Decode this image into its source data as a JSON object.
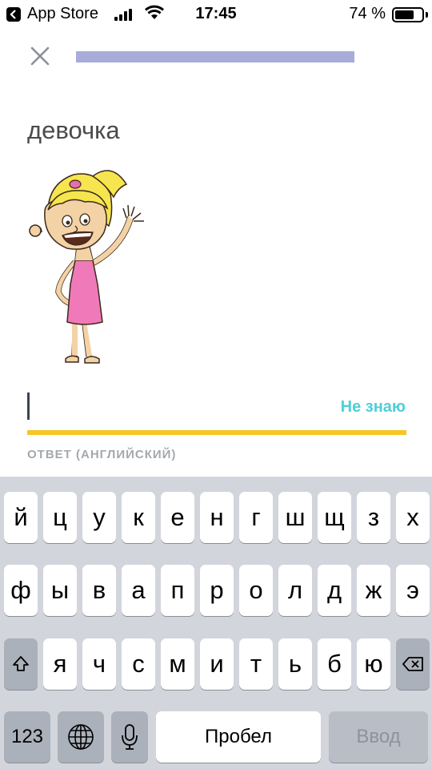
{
  "status_bar": {
    "back_app": "App Store",
    "time": "17:45",
    "battery_text": "74 %",
    "battery_level": 0.74
  },
  "lesson": {
    "progress": 1.0,
    "progress_color": "#a7acd9",
    "word": "девочка",
    "illustration": "girl-waving-illustration"
  },
  "answer": {
    "value": "",
    "dont_know_label": "Не знаю",
    "dont_know_color": "#4fcfd6",
    "hint": "ОТВЕТ (АНГЛИЙСКИЙ)",
    "underline_color": "#f5c626"
  },
  "keyboard": {
    "row1": [
      "й",
      "ц",
      "у",
      "к",
      "е",
      "н",
      "г",
      "ш",
      "щ",
      "з",
      "х"
    ],
    "row2": [
      "ф",
      "ы",
      "в",
      "а",
      "п",
      "р",
      "о",
      "л",
      "д",
      "ж",
      "э"
    ],
    "row3": [
      "я",
      "ч",
      "с",
      "м",
      "и",
      "т",
      "ь",
      "б",
      "ю"
    ],
    "numbers_label": "123",
    "space_label": "Пробел",
    "return_label": "Ввод",
    "shift_icon": "shift-icon",
    "delete_icon": "delete-icon",
    "globe_icon": "globe-icon",
    "mic_icon": "microphone-icon"
  }
}
